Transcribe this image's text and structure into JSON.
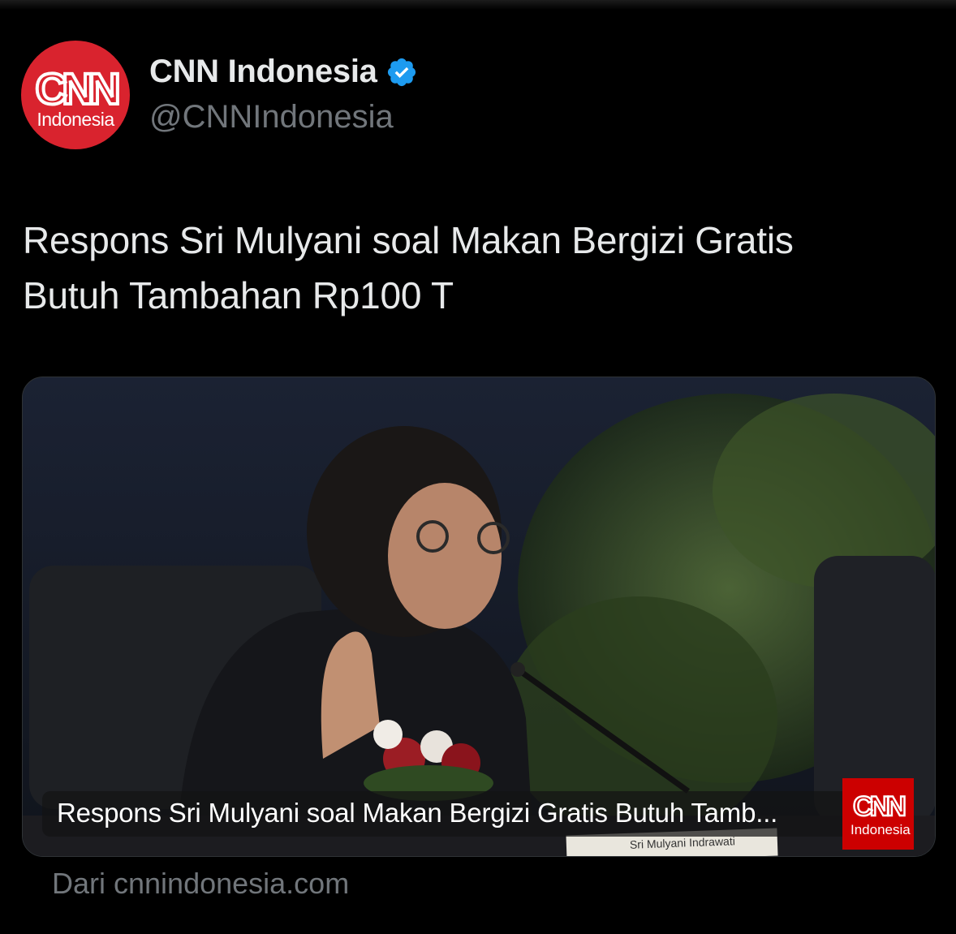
{
  "author": {
    "display_name": "CNN Indonesia",
    "handle": "@CNNIndonesia",
    "avatar_logo": "CNN",
    "avatar_logo_sub": "Indonesia",
    "verified_icon": "verified-badge-icon"
  },
  "tweet": {
    "text_line1": "Respons Sri Mulyani soal Makan Bergizi Gratis",
    "text_line2": "Butuh Tambahan Rp100 T"
  },
  "card": {
    "caption": "Respons Sri Mulyani soal Makan Bergizi Gratis Butuh Tamb...",
    "badge_logo": "CNN",
    "badge_sub": "Indonesia",
    "nameplate": "Sri Mulyani Indrawati",
    "source": "Dari cnnindonesia.com"
  },
  "colors": {
    "background": "#000000",
    "text_primary": "#e7e9ea",
    "text_secondary": "#71767b",
    "verified": "#1d9bf0",
    "brand_red": "#d9232e"
  }
}
